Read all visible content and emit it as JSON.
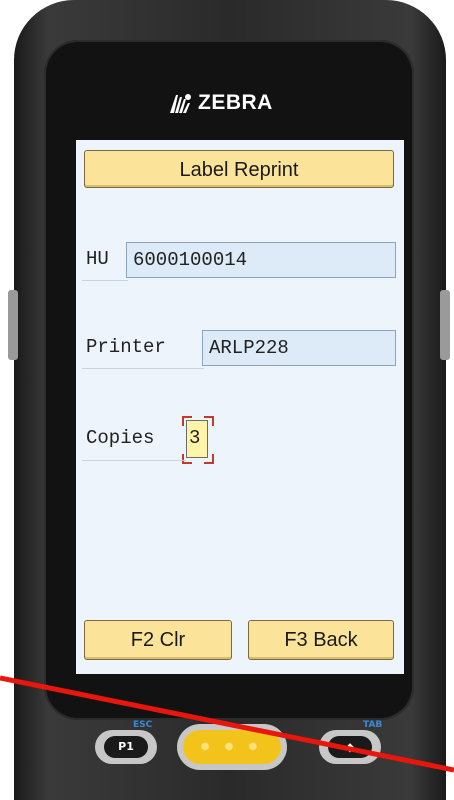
{
  "device": {
    "brand": "ZEBRA",
    "keys": {
      "p1": "P1",
      "esc": "ESC",
      "tab": "TAB"
    }
  },
  "screen": {
    "title": "Label Reprint",
    "fields": {
      "hu": {
        "label": "HU",
        "value": "6000100014"
      },
      "printer": {
        "label": "Printer",
        "value": "ARLP228"
      },
      "copies": {
        "label": "Copies",
        "value": "3"
      }
    },
    "buttons": {
      "clear": "F2 Clr",
      "back": "F3 Back"
    }
  },
  "colors": {
    "button": "#fbe49a",
    "field": "#ddeaf7",
    "screen": "#eef4fb",
    "annotation": "#e8160c"
  }
}
